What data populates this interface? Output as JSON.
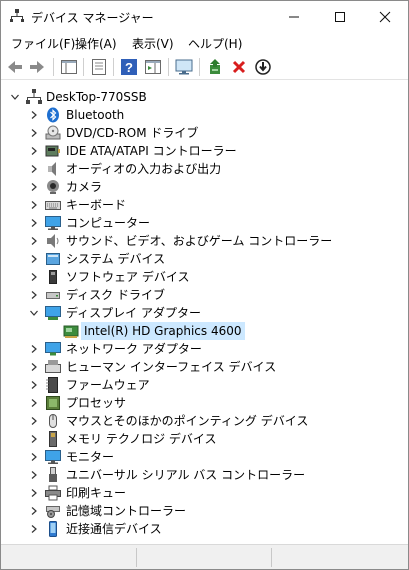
{
  "window": {
    "title": "デバイス マネージャー"
  },
  "menu": [
    {
      "label": "ファイル(F)"
    },
    {
      "label": "操作(A)"
    },
    {
      "label": "表示(V)"
    },
    {
      "label": "ヘルプ(H)"
    }
  ],
  "tree": {
    "root": "DeskTop-770SSB",
    "categories": [
      {
        "label": "Bluetooth",
        "icon": "bluetooth-icon"
      },
      {
        "label": "DVD/CD-ROM ドライブ",
        "icon": "dvd-drive-icon"
      },
      {
        "label": "IDE ATA/ATAPI コントローラー",
        "icon": "ide-controller-icon"
      },
      {
        "label": "オーディオの入力および出力",
        "icon": "speaker-icon"
      },
      {
        "label": "カメラ",
        "icon": "camera-icon"
      },
      {
        "label": "キーボード",
        "icon": "keyboard-icon"
      },
      {
        "label": "コンピューター",
        "icon": "computer-icon"
      },
      {
        "label": "サウンド、ビデオ、およびゲーム コントローラー",
        "icon": "sound-icon"
      },
      {
        "label": "システム デバイス",
        "icon": "system-device-icon"
      },
      {
        "label": "ソフトウェア デバイス",
        "icon": "software-device-icon"
      },
      {
        "label": "ディスク ドライブ",
        "icon": "disk-drive-icon"
      },
      {
        "label": "ディスプレイ アダプター",
        "icon": "display-adapter-icon",
        "expanded": true,
        "children": [
          {
            "label": "Intel(R) HD Graphics 4600",
            "icon": "display-adapter-icon",
            "selected": true
          }
        ]
      },
      {
        "label": "ネットワーク アダプター",
        "icon": "network-adapter-icon"
      },
      {
        "label": "ヒューマン インターフェイス デバイス",
        "icon": "hid-icon"
      },
      {
        "label": "ファームウェア",
        "icon": "firmware-icon"
      },
      {
        "label": "プロセッサ",
        "icon": "processor-icon"
      },
      {
        "label": "マウスとそのほかのポインティング デバイス",
        "icon": "mouse-icon"
      },
      {
        "label": "メモリ テクノロジ デバイス",
        "icon": "memory-icon"
      },
      {
        "label": "モニター",
        "icon": "monitor-icon"
      },
      {
        "label": "ユニバーサル シリアル バス コントローラー",
        "icon": "usb-icon"
      },
      {
        "label": "印刷キュー",
        "icon": "printer-icon"
      },
      {
        "label": "記憶域コントローラー",
        "icon": "storage-controller-icon"
      },
      {
        "label": "近接通信デバイス",
        "icon": "proximity-device-icon"
      }
    ]
  },
  "colors": {
    "selection": "#cce8ff",
    "accent": "#1e6fd0",
    "delete": "#d81e1e",
    "device_green": "#3c8c3c"
  }
}
